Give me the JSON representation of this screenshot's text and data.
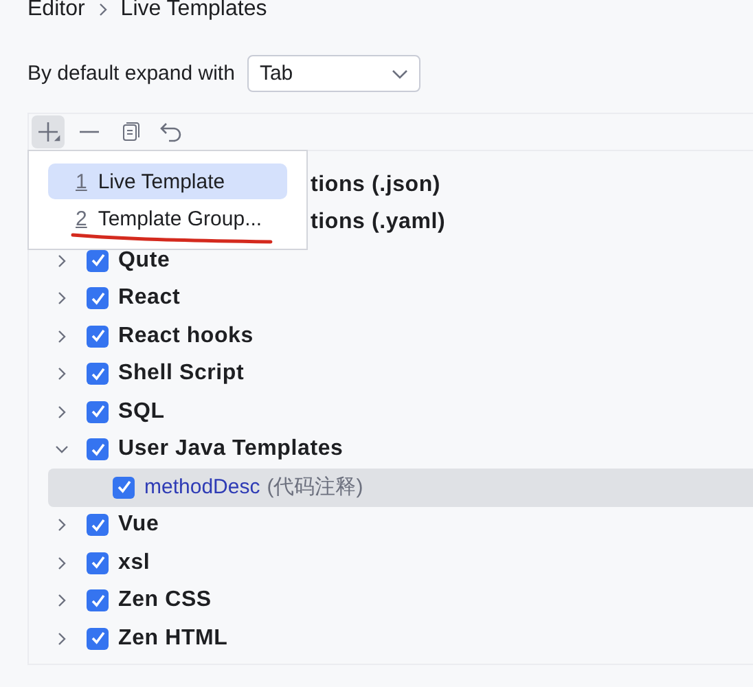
{
  "breadcrumb": [
    "Editor",
    "Live Templates"
  ],
  "expand_with": {
    "label": "By default expand with",
    "value": "Tab"
  },
  "toolbar": [
    {
      "kind": "add"
    },
    {
      "kind": "remove"
    },
    {
      "kind": "copy"
    },
    {
      "kind": "undo"
    }
  ],
  "add_menu": [
    {
      "mnemonic": "1",
      "label": "Live Template",
      "selected": true
    },
    {
      "mnemonic": "2",
      "label": "Template Group...",
      "selected": false
    }
  ],
  "tree": [
    {
      "kind": "partial",
      "label": "tions (.json)"
    },
    {
      "kind": "partial",
      "label": "tions (.yaml)"
    },
    {
      "kind": "group",
      "label": "Qute",
      "checked": true,
      "expanded": false
    },
    {
      "kind": "group",
      "label": "React",
      "checked": true,
      "expanded": false
    },
    {
      "kind": "group",
      "label": "React hooks",
      "checked": true,
      "expanded": false
    },
    {
      "kind": "group",
      "label": "Shell Script",
      "checked": true,
      "expanded": false
    },
    {
      "kind": "group",
      "label": "SQL",
      "checked": true,
      "expanded": false
    },
    {
      "kind": "group",
      "label": "User Java Templates",
      "checked": true,
      "expanded": true,
      "children": [
        {
          "label": "methodDesc",
          "description": "(代码注释)",
          "checked": true,
          "selected": true
        }
      ]
    },
    {
      "kind": "group",
      "label": "Vue",
      "checked": true,
      "expanded": false
    },
    {
      "kind": "group",
      "label": "xsl",
      "checked": true,
      "expanded": false
    },
    {
      "kind": "group",
      "label": "Zen CSS",
      "checked": true,
      "expanded": false
    },
    {
      "kind": "group",
      "label": "Zen HTML",
      "checked": true,
      "expanded": false
    }
  ]
}
